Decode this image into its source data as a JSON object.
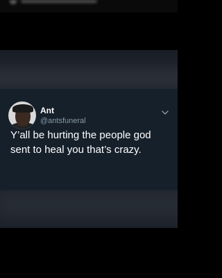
{
  "tweet": {
    "name": "Ant",
    "handle": "@antsfuneral",
    "text": "Y’all be hurting the people god sent to heal you that’s crazy.",
    "avatar_icon": "profile-photo",
    "menu_icon": "chevron-down-icon"
  },
  "colors": {
    "card_background": "#16202b",
    "text_primary": "#ffffff",
    "text_secondary": "#8899a6",
    "page_background": "#000000"
  }
}
